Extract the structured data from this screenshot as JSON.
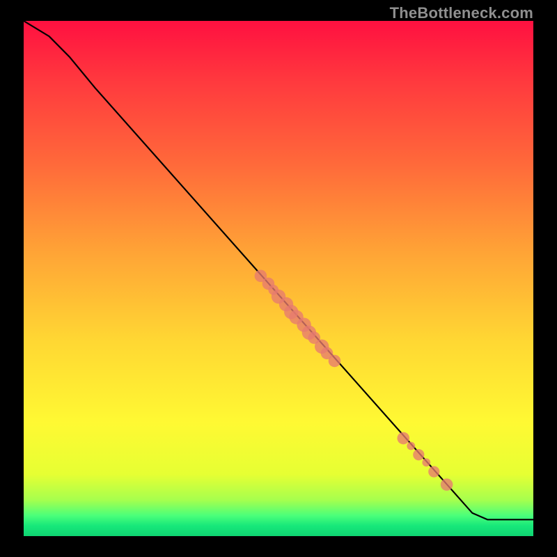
{
  "watermark": "TheBottleneck.com",
  "chart_data": {
    "type": "line",
    "title": "",
    "xlabel": "",
    "ylabel": "",
    "xlim": [
      0,
      100
    ],
    "ylim": [
      0,
      100
    ],
    "curve": [
      {
        "x": 0,
        "y": 100
      },
      {
        "x": 5,
        "y": 97
      },
      {
        "x": 9,
        "y": 93
      },
      {
        "x": 14,
        "y": 87
      },
      {
        "x": 88,
        "y": 4.5
      },
      {
        "x": 91,
        "y": 3.2
      },
      {
        "x": 100,
        "y": 3.2
      }
    ],
    "markers": [
      {
        "x": 46.5,
        "y": 50.5,
        "r": 1.2
      },
      {
        "x": 48.0,
        "y": 49.0,
        "r": 1.2
      },
      {
        "x": 49.0,
        "y": 47.8,
        "r": 1.0
      },
      {
        "x": 50.0,
        "y": 46.5,
        "r": 1.4
      },
      {
        "x": 51.5,
        "y": 45.0,
        "r": 1.4
      },
      {
        "x": 52.5,
        "y": 43.5,
        "r": 1.4
      },
      {
        "x": 53.5,
        "y": 42.5,
        "r": 1.4
      },
      {
        "x": 55.0,
        "y": 41.0,
        "r": 1.4
      },
      {
        "x": 56.0,
        "y": 39.5,
        "r": 1.4
      },
      {
        "x": 57.0,
        "y": 38.5,
        "r": 1.2
      },
      {
        "x": 58.5,
        "y": 36.8,
        "r": 1.4
      },
      {
        "x": 59.5,
        "y": 35.5,
        "r": 1.2
      },
      {
        "x": 61.0,
        "y": 34.0,
        "r": 1.2
      },
      {
        "x": 74.5,
        "y": 19.0,
        "r": 1.2
      },
      {
        "x": 76.0,
        "y": 17.5,
        "r": 0.8
      },
      {
        "x": 77.5,
        "y": 15.8,
        "r": 1.1
      },
      {
        "x": 79.0,
        "y": 14.3,
        "r": 0.8
      },
      {
        "x": 80.5,
        "y": 12.5,
        "r": 1.1
      },
      {
        "x": 83.0,
        "y": 10.0,
        "r": 1.2
      }
    ],
    "gradient_stops": [
      {
        "pos": 0.0,
        "color": "#ff1040"
      },
      {
        "pos": 0.5,
        "color": "#ffd733"
      },
      {
        "pos": 0.9,
        "color": "#e6ff33"
      },
      {
        "pos": 1.0,
        "color": "#0fd472"
      }
    ]
  }
}
